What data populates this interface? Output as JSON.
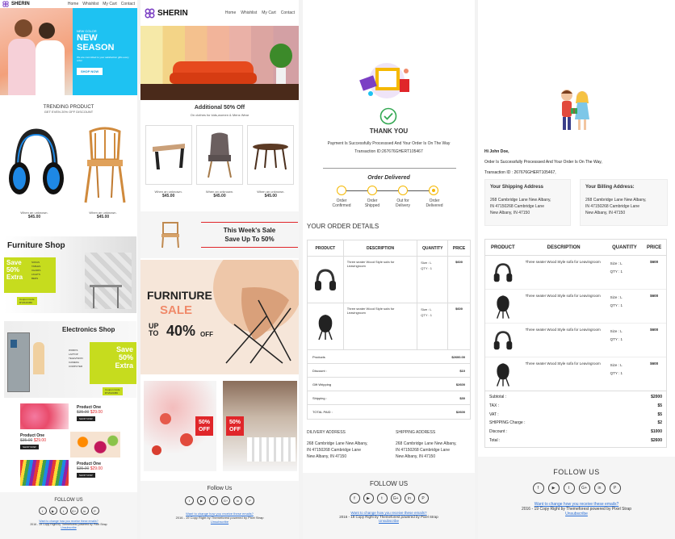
{
  "brand": "SHERIN",
  "nav": [
    "Home",
    "Whishlist",
    "My Cart",
    "Contact"
  ],
  "col1": {
    "hero_kicker": "NEW COLOR",
    "hero_title_1": "NEW",
    "hero_title_2": "SEASON",
    "hero_sub": "We are committed to your satisfaction gifts every order",
    "hero_btn": "SHOP NOW",
    "trending_title": "TRENDING PRODUCT",
    "trending_sub": "GET EVEN 20% OFF DISCOUNT",
    "products": [
      {
        "name": "When an unknown.",
        "price": "$45.00"
      },
      {
        "name": "When an unknown.",
        "price": "$45.00"
      }
    ],
    "furniture_title": "Furniture Shop",
    "save_l1": "Save",
    "save_l2": "50%",
    "save_l3": "Extra",
    "furniture_list": [
      "SOFAS",
      "TABLES",
      "CHAIRS",
      "LIGHTS",
      "BEDS"
    ],
    "coupon_label": "Coupon Code",
    "coupon_code": "RYZ123456",
    "electronics_title": "Electronics Shop",
    "electronics_list": [
      "WORKS",
      "LAPTOP",
      "TELEVISION",
      "CAMERA",
      "COMPUTER"
    ],
    "items": [
      {
        "title": "Product One",
        "old": "$35.00",
        "new": "$29.00",
        "btn": "SHOP NOW"
      },
      {
        "title": "Product One",
        "old": "$35.00",
        "new": "$29.00",
        "btn": "SHOP NOW"
      },
      {
        "title": "Product One",
        "old": "$35.00",
        "new": "$29.00",
        "btn": "SHOP NOW"
      }
    ],
    "follow": "FOLLOW US",
    "footer_link": "Want to change how you receive these emails?",
    "footer_copy": "2016 - 19 Copy Right by Themeforest powered by Pixel Strap",
    "unsubscribe": "Unsubscribe"
  },
  "col2": {
    "offer_title": "Additional 50% Off",
    "offer_sub": "On clothes for kids,women & Mens Wear",
    "products": [
      {
        "name": "When an unknown.",
        "price": "$45.00"
      },
      {
        "name": "When an unknown.",
        "price": "$45.00"
      },
      {
        "name": "When an unknown.",
        "price": "$45.00"
      }
    ],
    "weekly_1": "This Week's Sale",
    "weekly_2": "Save Up To 50%",
    "banner_1": "FURNITURE",
    "banner_2": "SALE",
    "banner_3": "UP",
    "banner_4": "TO",
    "banner_5": "40%",
    "banner_6": "OFF",
    "tag_1": "50%",
    "tag_2": "OFF",
    "follow": "Follow Us",
    "footer_link": "Want to change how you receive these emails?",
    "footer_copy": "2016 - 19 Copy Right by Themeforest powered by Pixel Strap",
    "unsubscribe": "Unsubscribe"
  },
  "col3": {
    "thank_you": "THANK YOU",
    "msg": "Payment Is Successfully Processsed And Your Order Is On The Way",
    "txn": "Transaction ID:267676GHERT105467",
    "order_delivered": "Order Delivered",
    "steps": [
      "Order Confirmed",
      "Order Shipped",
      "Out for Delivery",
      "Order Delivered"
    ],
    "details_title": "YOUR ORDER DETAILS",
    "headers": [
      "PRODUCT",
      "DESCRIPTION",
      "QUANTITY",
      "PRICE"
    ],
    "rows": [
      {
        "desc": "Three seater Wood Style sofa for Leavingroom",
        "size": "Size : L",
        "qty": "QTY : 1",
        "price": "$600"
      },
      {
        "desc": "Three seater Wood Style sofa for Leavingroom",
        "size": "Size : L",
        "qty": "QTY : 1",
        "price": "$600"
      }
    ],
    "totals": [
      {
        "label": "Products",
        "value": "$2600.00"
      },
      {
        "label": "Discount :",
        "value": "$10"
      },
      {
        "label": "Gift Wripping",
        "value": "$2600"
      },
      {
        "label": "Shipping :",
        "value": "$30"
      },
      {
        "label": "TOTAL PAID :",
        "value": "$2600"
      }
    ],
    "delivery_title": "DILIVERY ADDRESS",
    "shipping_title": "SHIPPING ADDRESS",
    "address": [
      "268 Cambridge Lane New Albany,",
      "IN 47150268 Cambridge Lane",
      "New Albany, IN 47150"
    ],
    "follow": "FOLLOW US",
    "footer_link": "Want to change how you receive these emails?",
    "footer_copy": "2016 - 19 Copy Right by Themeforest powered by Pixel Strap",
    "unsubscribe": "Unsubscribe"
  },
  "col4": {
    "greeting": "Hi John Doe,",
    "msg": "Order Is Successfully Processsed And Your Order Is On The Way,",
    "txn": "Transaction ID : 267676GHERT105467,",
    "ship_title": "Your Shipping Address",
    "bill_title": "Your Billing Address:",
    "address": [
      "268 Cambridge Lane New Albany,",
      "IN 47150268 Cambridge Lane",
      "New Albany, IN 47150"
    ],
    "headers": [
      "PRODUCT",
      "DESCRIPTION",
      "QUANTITY",
      "PRICE"
    ],
    "rows": [
      {
        "desc": "Three seater Wood Style sofa for Leavingroom",
        "size": "Size : L",
        "qty": "QTY : 1",
        "price": "$600"
      },
      {
        "desc": "Three seater Wood Style sofa for Leavingroom",
        "size": "Size : L",
        "qty": "QTY : 1",
        "price": "$600"
      },
      {
        "desc": "Three seater Wood Style sofa for Leavingroom",
        "size": "Size : L",
        "qty": "QTY : 1",
        "price": "$600"
      },
      {
        "desc": "Three seater Wood Style sofa for Leavingroom",
        "size": "Size : L",
        "qty": "QTY : 1",
        "price": "$600"
      }
    ],
    "totals": [
      {
        "label": "Subtotal :",
        "value": "$2000"
      },
      {
        "label": "TAX :",
        "value": "$5"
      },
      {
        "label": "VAT :",
        "value": "$5"
      },
      {
        "label": "SHIPPING Charge :",
        "value": "$2"
      },
      {
        "label": "Discount :",
        "value": "$1000"
      },
      {
        "label": "Total :",
        "value": "$2600"
      }
    ],
    "follow": "FOLLOW US",
    "footer_link": "Want to change how you receive these emails?",
    "footer_copy": "2016 - 19 Copy Right by Themeforest powered by Pixel Strap",
    "unsubscribe": "Unsubscribe"
  },
  "social_icons": [
    "facebook-icon",
    "youtube-icon",
    "twitter-icon",
    "google-plus-icon",
    "linkedin-icon",
    "pinterest-icon"
  ],
  "social_glyphs": [
    "f",
    "▶",
    "t",
    "G+",
    "in",
    "P"
  ],
  "colors": {
    "accent_blue": "#1ec2f2",
    "lime": "#c6dc1e",
    "red": "#e0262a",
    "coral": "#f08a6a",
    "gold": "#f5b800",
    "green": "#34a853"
  }
}
